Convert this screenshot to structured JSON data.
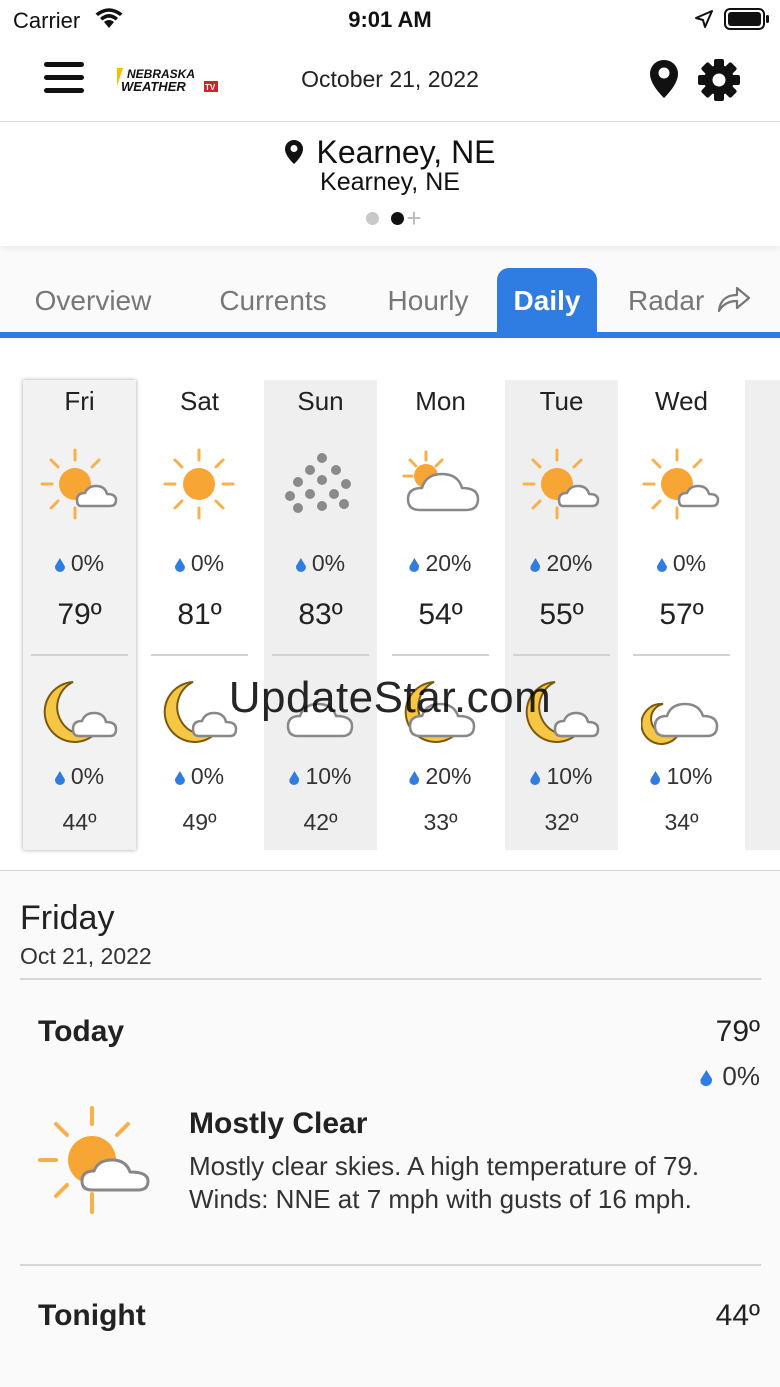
{
  "status_bar": {
    "carrier": "Carrier",
    "time": "9:01 AM"
  },
  "header": {
    "date": "October 21, 2022",
    "logo_line1": "NEBRASKA",
    "logo_line2": "WEATHER",
    "logo_badge": "TV"
  },
  "location": {
    "title": "Kearney, NE",
    "subtitle": "Kearney, NE",
    "page_dots": 2,
    "active_dot": 1
  },
  "tabs": [
    {
      "label": "Overview",
      "active": false
    },
    {
      "label": "Currents",
      "active": false
    },
    {
      "label": "Hourly",
      "active": false
    },
    {
      "label": "Daily",
      "active": true
    },
    {
      "label": "Radar",
      "active": false
    }
  ],
  "days": [
    {
      "name": "Fri",
      "day_icon": "partly-sunny-icon",
      "day_precip": "0%",
      "high": "79º",
      "night_icon": "moon-cloud-icon",
      "night_precip": "0%",
      "low": "44º"
    },
    {
      "name": "Sat",
      "day_icon": "sun-icon",
      "day_precip": "0%",
      "high": "81º",
      "night_icon": "moon-cloud-icon",
      "night_precip": "0%",
      "low": "49º"
    },
    {
      "name": "Sun",
      "day_icon": "hail-dots-icon",
      "day_precip": "0%",
      "high": "83º",
      "night_icon": "cloud-icon",
      "night_precip": "10%",
      "low": "42º"
    },
    {
      "name": "Mon",
      "day_icon": "mostly-cloudy-sun-icon",
      "day_precip": "20%",
      "high": "54º",
      "night_icon": "moon-cloud-icon",
      "night_precip": "20%",
      "low": "33º"
    },
    {
      "name": "Tue",
      "day_icon": "partly-sunny-icon",
      "day_precip": "20%",
      "high": "55º",
      "night_icon": "moon-cloud-icon",
      "night_precip": "10%",
      "low": "32º"
    },
    {
      "name": "Wed",
      "day_icon": "partly-sunny-icon",
      "day_precip": "0%",
      "high": "57º",
      "night_icon": "moon-cloud-icon",
      "night_precip": "10%",
      "low": "34º"
    }
  ],
  "detail": {
    "day": "Friday",
    "date": "Oct 21, 2022",
    "today_label": "Today",
    "today_high": "79º",
    "today_precip": "0%",
    "condition": "Mostly Clear",
    "description": "Mostly clear skies. A high temperature of 79. Winds: NNE at 7 mph with gusts of 16 mph.",
    "tonight_label": "Tonight",
    "tonight_low": "44º"
  },
  "watermark": "UpdateStar.com",
  "colors": {
    "accent": "#2f7ce3",
    "sun": "#f7a535",
    "sun_rays": "#f7b04a",
    "moon": "#f6c744",
    "cloud": "#ffffff",
    "cloud_stroke": "#888888",
    "hail": "#8a8a8a"
  }
}
